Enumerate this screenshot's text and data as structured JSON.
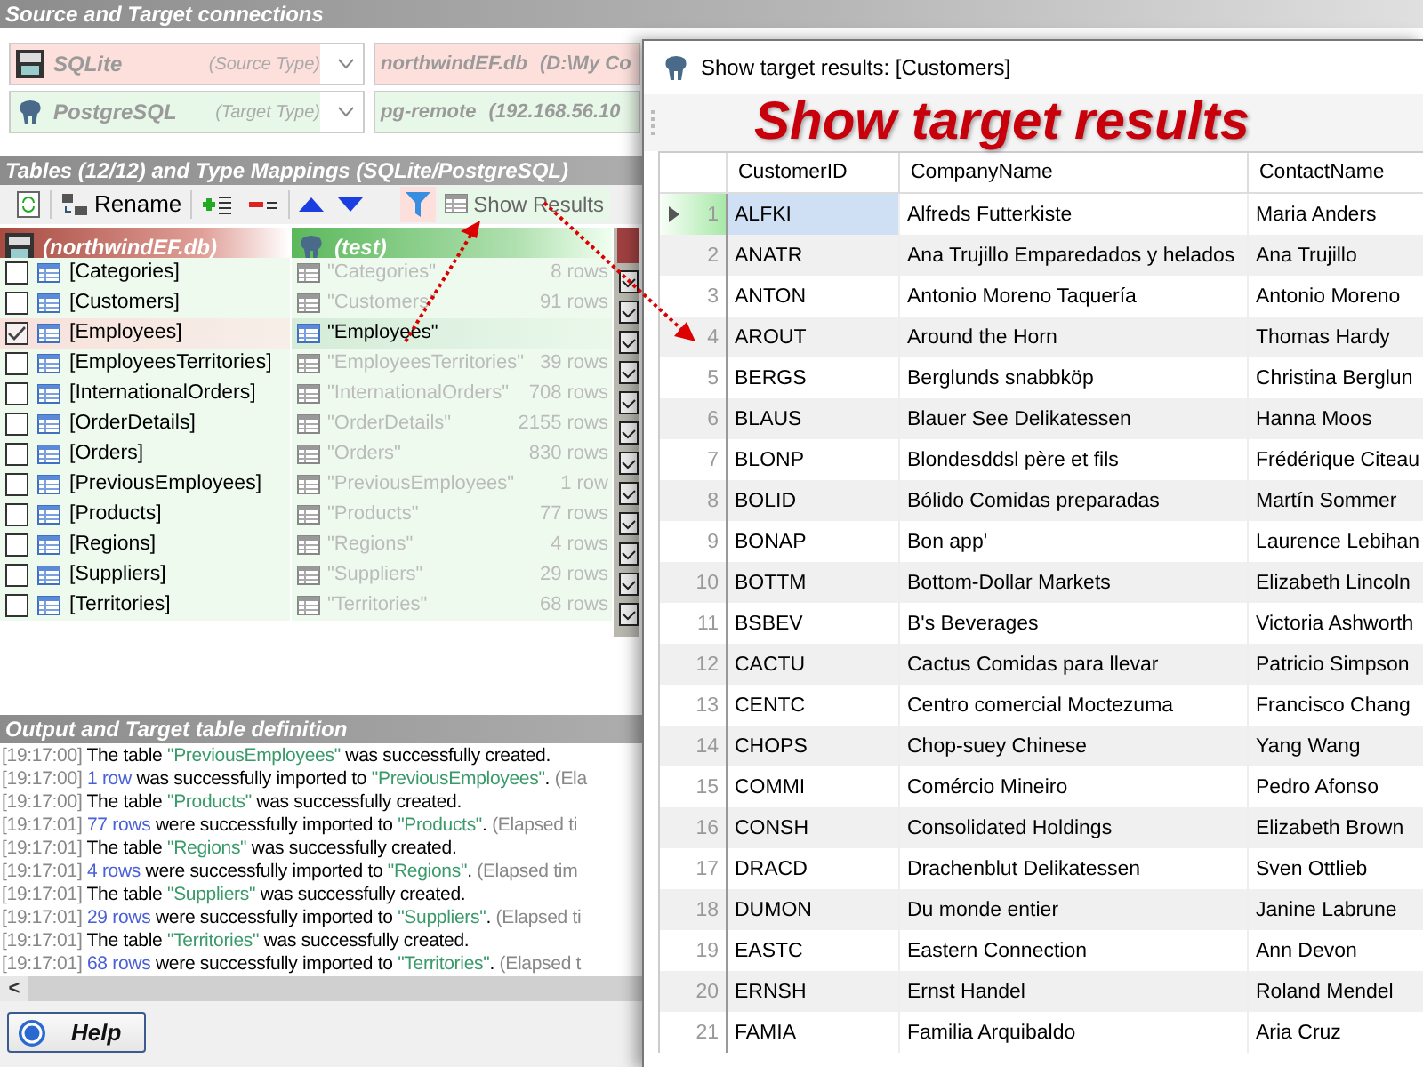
{
  "connections_panel": {
    "title": "Source and Target connections",
    "connections": [
      {
        "kind": "source",
        "db_type": "SQLite",
        "role": "(Source Type)",
        "name": "northwindEF.db",
        "location": "(D:\\My Co"
      },
      {
        "kind": "target",
        "db_type": "PostgreSQL",
        "role": "(Target Type)",
        "name": "pg-remote",
        "location": "(192.168.56.10"
      }
    ]
  },
  "tables_panel": {
    "title": "Tables (12/12) and Type Mappings (SQLite/PostgreSQL)",
    "toolbar": {
      "rename": "Rename",
      "show_results": "Show Results"
    },
    "source_header": "(northwindEF.db)",
    "target_header": "(test)",
    "rows": [
      {
        "source": "[Categories]",
        "target": "\"Categories\"",
        "count": "8 rows",
        "checked": false
      },
      {
        "source": "[Customers]",
        "target": "\"Customers\"",
        "count": "91 rows",
        "checked": false
      },
      {
        "source": "[Employees]",
        "target": "\"Employees\"",
        "checked": true
      },
      {
        "source": "[EmployeesTerritories]",
        "target": "\"EmployeesTerritories\"",
        "count": "39 rows",
        "checked": false
      },
      {
        "source": "[InternationalOrders]",
        "target": "\"InternationalOrders\"",
        "count": "708 rows",
        "checked": false
      },
      {
        "source": "[OrderDetails]",
        "target": "\"OrderDetails\"",
        "count": "2155 rows",
        "checked": false
      },
      {
        "source": "[Orders]",
        "target": "\"Orders\"",
        "count": "830 rows",
        "checked": false
      },
      {
        "source": "[PreviousEmployees]",
        "target": "\"PreviousEmployees\"",
        "count": "1 row",
        "checked": false
      },
      {
        "source": "[Products]",
        "target": "\"Products\"",
        "count": "77 rows",
        "checked": false
      },
      {
        "source": "[Regions]",
        "target": "\"Regions\"",
        "count": "4 rows",
        "checked": false
      },
      {
        "source": "[Suppliers]",
        "target": "\"Suppliers\"",
        "count": "29 rows",
        "checked": false
      },
      {
        "source": "[Territories]",
        "target": "\"Territories\"",
        "count": "68 rows",
        "checked": false
      }
    ]
  },
  "output_panel": {
    "title": "Output and Target table definition",
    "lines": [
      [
        {
          "kind": "time",
          "text": "[19:17:00]"
        },
        {
          "kind": "plain",
          "text": " The table "
        },
        {
          "kind": "name",
          "text": "\"PreviousEmployees\""
        },
        {
          "kind": "plain",
          "text": " was successfully created."
        }
      ],
      [
        {
          "kind": "time",
          "text": "[19:17:00]"
        },
        {
          "kind": "count",
          "text": " 1 row"
        },
        {
          "kind": "plain",
          "text": " was successfully imported to "
        },
        {
          "kind": "name",
          "text": "\"PreviousEmployees\""
        },
        {
          "kind": "plain",
          "text": ". "
        },
        {
          "kind": "note",
          "text": "(Ela"
        }
      ],
      [
        {
          "kind": "time",
          "text": "[19:17:00]"
        },
        {
          "kind": "plain",
          "text": " The table "
        },
        {
          "kind": "name",
          "text": "\"Products\""
        },
        {
          "kind": "plain",
          "text": " was successfully created."
        }
      ],
      [
        {
          "kind": "time",
          "text": "[19:17:01]"
        },
        {
          "kind": "count",
          "text": " 77 rows"
        },
        {
          "kind": "plain",
          "text": " were successfully imported to "
        },
        {
          "kind": "name",
          "text": "\"Products\""
        },
        {
          "kind": "plain",
          "text": ". "
        },
        {
          "kind": "note",
          "text": "(Elapsed ti"
        }
      ],
      [
        {
          "kind": "time",
          "text": "[19:17:01]"
        },
        {
          "kind": "plain",
          "text": " The table "
        },
        {
          "kind": "name",
          "text": "\"Regions\""
        },
        {
          "kind": "plain",
          "text": " was successfully created."
        }
      ],
      [
        {
          "kind": "time",
          "text": "[19:17:01]"
        },
        {
          "kind": "count",
          "text": " 4 rows"
        },
        {
          "kind": "plain",
          "text": " were successfully imported to "
        },
        {
          "kind": "name",
          "text": "\"Regions\""
        },
        {
          "kind": "plain",
          "text": ". "
        },
        {
          "kind": "note",
          "text": "(Elapsed tim"
        }
      ],
      [
        {
          "kind": "time",
          "text": "[19:17:01]"
        },
        {
          "kind": "plain",
          "text": " The table "
        },
        {
          "kind": "name",
          "text": "\"Suppliers\""
        },
        {
          "kind": "plain",
          "text": " was successfully created."
        }
      ],
      [
        {
          "kind": "time",
          "text": "[19:17:01]"
        },
        {
          "kind": "count",
          "text": " 29 rows"
        },
        {
          "kind": "plain",
          "text": " were successfully imported to "
        },
        {
          "kind": "name",
          "text": "\"Suppliers\""
        },
        {
          "kind": "plain",
          "text": ". "
        },
        {
          "kind": "note",
          "text": "(Elapsed ti"
        }
      ],
      [
        {
          "kind": "time",
          "text": "[19:17:01]"
        },
        {
          "kind": "plain",
          "text": " The table "
        },
        {
          "kind": "name",
          "text": "\"Territories\""
        },
        {
          "kind": "plain",
          "text": " was successfully created."
        }
      ],
      [
        {
          "kind": "time",
          "text": "[19:17:01]"
        },
        {
          "kind": "count",
          "text": " 68 rows"
        },
        {
          "kind": "plain",
          "text": " were successfully imported to "
        },
        {
          "kind": "name",
          "text": "\"Territories\""
        },
        {
          "kind": "plain",
          "text": ". "
        },
        {
          "kind": "note",
          "text": "(Elapsed t"
        }
      ]
    ],
    "scroll_left": "<"
  },
  "help_button": "Help",
  "results_window": {
    "title": "Show target results: [Customers]",
    "annotation": "Show target results",
    "columns": [
      "CustomerID",
      "CompanyName",
      "ContactName"
    ],
    "rows": [
      {
        "number": "1",
        "cells": [
          "ALFKI",
          "Alfreds Futterkiste",
          "Maria Anders"
        ],
        "selected": true
      },
      {
        "number": "2",
        "cells": [
          "ANATR",
          "Ana Trujillo Emparedados y helados",
          "Ana Trujillo"
        ],
        "selected": false
      },
      {
        "number": "3",
        "cells": [
          "ANTON",
          "Antonio Moreno Taquería",
          "Antonio Moreno"
        ],
        "selected": false
      },
      {
        "number": "4",
        "cells": [
          "AROUT",
          "Around the Horn",
          "Thomas Hardy"
        ],
        "selected": false
      },
      {
        "number": "5",
        "cells": [
          "BERGS",
          "Berglunds snabbköp",
          "Christina Berglun"
        ],
        "selected": false
      },
      {
        "number": "6",
        "cells": [
          "BLAUS",
          "Blauer See Delikatessen",
          "Hanna Moos"
        ],
        "selected": false
      },
      {
        "number": "7",
        "cells": [
          "BLONP",
          "Blondesddsl père et fils",
          "Frédérique Citeau"
        ],
        "selected": false
      },
      {
        "number": "8",
        "cells": [
          "BOLID",
          "Bólido Comidas preparadas",
          "Martín Sommer"
        ],
        "selected": false
      },
      {
        "number": "9",
        "cells": [
          "BONAP",
          "Bon app'",
          "Laurence Lebihan"
        ],
        "selected": false
      },
      {
        "number": "10",
        "cells": [
          "BOTTM",
          "Bottom-Dollar Markets",
          "Elizabeth Lincoln"
        ],
        "selected": false
      },
      {
        "number": "11",
        "cells": [
          "BSBEV",
          "B's Beverages",
          "Victoria Ashworth"
        ],
        "selected": false
      },
      {
        "number": "12",
        "cells": [
          "CACTU",
          "Cactus Comidas para llevar",
          "Patricio Simpson"
        ],
        "selected": false
      },
      {
        "number": "13",
        "cells": [
          "CENTC",
          "Centro comercial Moctezuma",
          "Francisco Chang"
        ],
        "selected": false
      },
      {
        "number": "14",
        "cells": [
          "CHOPS",
          "Chop-suey Chinese",
          "Yang Wang"
        ],
        "selected": false
      },
      {
        "number": "15",
        "cells": [
          "COMMI",
          "Comércio Mineiro",
          "Pedro Afonso"
        ],
        "selected": false
      },
      {
        "number": "16",
        "cells": [
          "CONSH",
          "Consolidated Holdings",
          "Elizabeth Brown"
        ],
        "selected": false
      },
      {
        "number": "17",
        "cells": [
          "DRACD",
          "Drachenblut Delikatessen",
          "Sven Ottlieb"
        ],
        "selected": false
      },
      {
        "number": "18",
        "cells": [
          "DUMON",
          "Du monde entier",
          "Janine Labrune"
        ],
        "selected": false
      },
      {
        "number": "19",
        "cells": [
          "EASTC",
          "Eastern Connection",
          "Ann Devon"
        ],
        "selected": false
      },
      {
        "number": "20",
        "cells": [
          "ERNSH",
          "Ernst Handel",
          "Roland Mendel"
        ],
        "selected": false
      },
      {
        "number": "21",
        "cells": [
          "FAMIA",
          "Familia Arquibaldo",
          "Aria Cruz"
        ],
        "selected": false
      }
    ]
  }
}
